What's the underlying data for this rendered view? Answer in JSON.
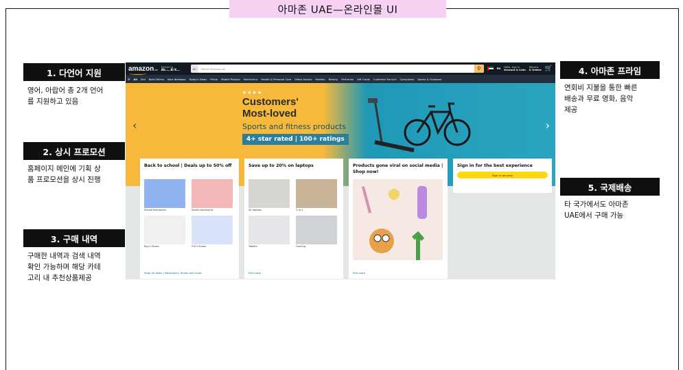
{
  "title": "아마존 UAE—온라인몰 UI",
  "annotations": {
    "multilang": {
      "label": "1. 다언어 지원",
      "desc": [
        "영어, 아랍어 총 2개 언어",
        "를 지원하고 있음"
      ]
    },
    "promo": {
      "label": "2. 상시 프로모션",
      "desc": [
        "홈페이지 메인에 기획 상",
        "품 프로모션을 상시 진행"
      ]
    },
    "history": {
      "label": "3. 구매 내역",
      "desc": [
        "구매한 내역과 검색 내역",
        "확인 가능하며 해당 카테",
        "고리 내 추천상품제공"
      ]
    },
    "prime": {
      "label": "4. 아마존 프라임",
      "desc": [
        "연회비 지불을 통한 빠른",
        "배송과 무료 영화, 음악",
        "제공"
      ]
    },
    "intl": {
      "label": "5. 국제배송",
      "desc": [
        "타 국가에서도 아마존",
        "UAE에서 구매 가능"
      ]
    }
  },
  "amazon": {
    "logo": "amazon",
    "logo_suffix": ".ae",
    "deliver_to": "Deliver to",
    "deliver_loc": "Ab..., Al K...",
    "search_category": "All",
    "search_placeholder": "Search Amazon.ae",
    "lang": "EN",
    "account_hello": "Hello, sign in",
    "account_lists": "Account & Lists",
    "returns": "Returns",
    "orders": "& Orders",
    "nav_items": [
      "All",
      "Sell",
      "Best Sellers",
      "New Releases",
      "Today's Deals",
      "Prime",
      "Mobile Phones",
      "Electronics",
      "Health & Personal Care",
      "Video Games",
      "Fashion",
      "Beauty",
      "Perfumes",
      "Gift Cards",
      "Customer Service",
      "Computers",
      "Sports & Outdoors"
    ],
    "hero": {
      "stars": "★★★★",
      "headline1": "Customers'",
      "headline2": "Most-loved",
      "sub": "Sports and fitness products",
      "tag": "4+ star rated | 100+ ratings"
    },
    "cards": [
      {
        "title": "Back to school | Deals up to 50% off",
        "tiles": [
          "School backpacks",
          "Sports backpacks",
          "Boy's Shoes",
          "Girl's Shoes"
        ],
        "tile_colors": [
          "#8fb3f0",
          "#f4b8b8",
          "#eef0f2",
          "#d9e2f8"
        ],
        "footer": "Shop all deals | Backpacks, Shoes and more"
      },
      {
        "title": "Save up to 20% on laptops",
        "tiles": [
          "All laptops",
          "2-in-1",
          "Tablets",
          "Gaming"
        ],
        "tile_colors": [
          "#d8d6d3",
          "#c9b49a",
          "#e4e6ea",
          "#cfd3d8"
        ],
        "footer": "See more"
      },
      {
        "title": "Products gone viral on social media | Shop now!",
        "footer": "See more"
      },
      {
        "title": "Sign in for the best experience",
        "button": "Sign in securely"
      }
    ]
  }
}
